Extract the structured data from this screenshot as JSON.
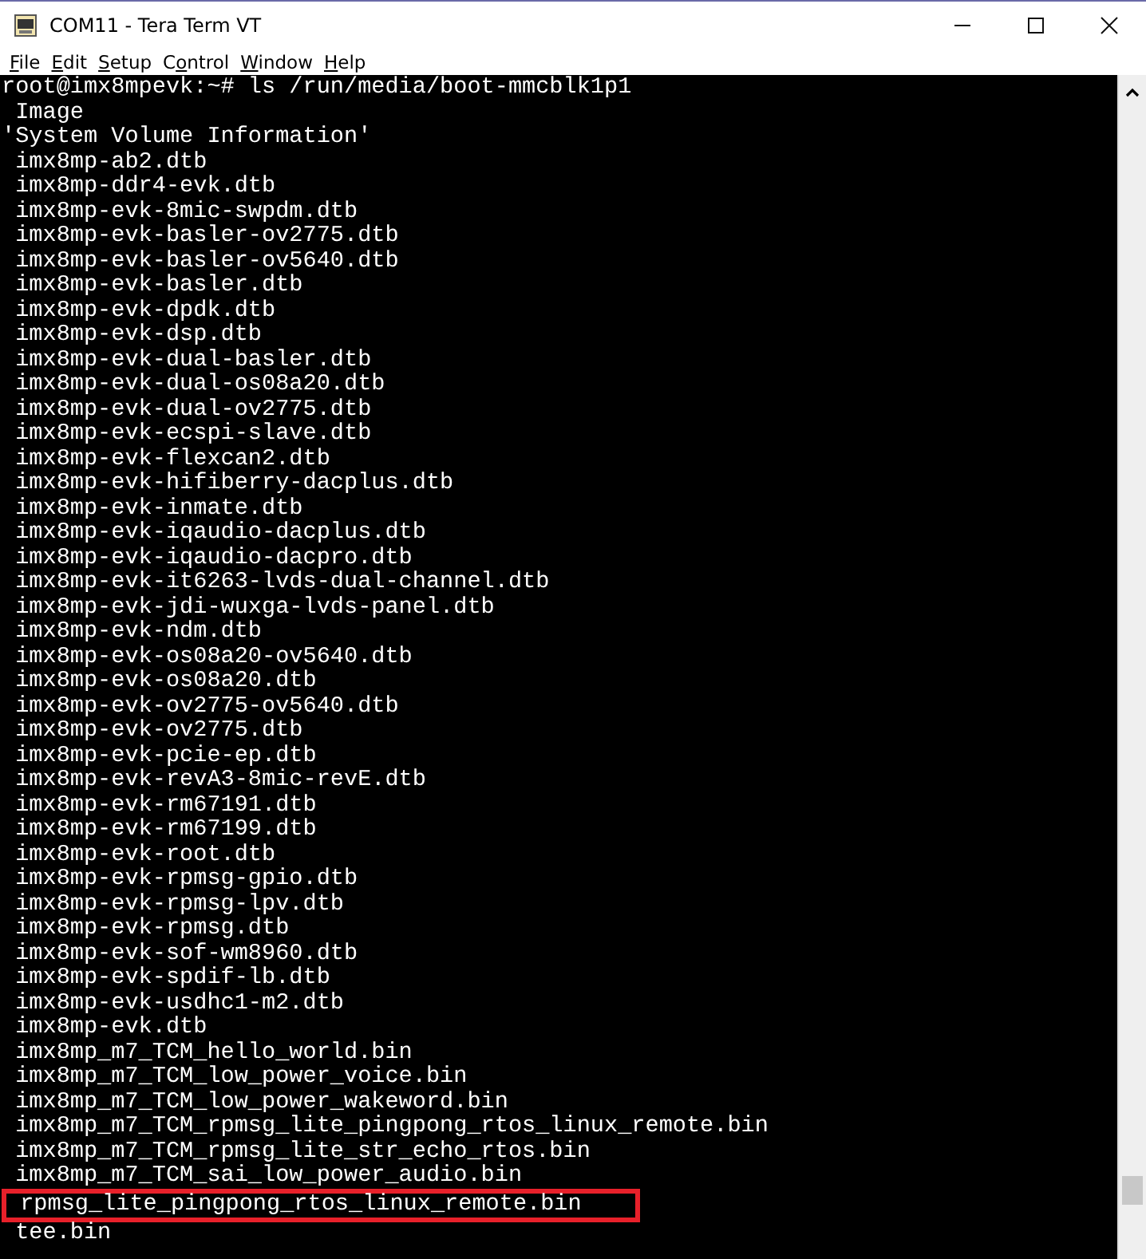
{
  "window": {
    "title": "COM11 - Tera Term VT"
  },
  "menu": [
    {
      "key": "F",
      "post": "ile"
    },
    {
      "key": "E",
      "post": "dit"
    },
    {
      "key": "S",
      "post": "etup"
    },
    {
      "pre": "C",
      "key": "o",
      "post": "ntrol"
    },
    {
      "key": "W",
      "post": "indow"
    },
    {
      "key": "H",
      "post": "elp"
    }
  ],
  "terminal": {
    "lines": [
      {
        "text": "root@imx8mpevk:~# ls /run/media/boot-mmcblk1p1",
        "highlighted": false
      },
      {
        "text": " Image",
        "highlighted": false
      },
      {
        "text": "'System Volume Information'",
        "highlighted": false
      },
      {
        "text": " imx8mp-ab2.dtb",
        "highlighted": false
      },
      {
        "text": " imx8mp-ddr4-evk.dtb",
        "highlighted": false
      },
      {
        "text": " imx8mp-evk-8mic-swpdm.dtb",
        "highlighted": false
      },
      {
        "text": " imx8mp-evk-basler-ov2775.dtb",
        "highlighted": false
      },
      {
        "text": " imx8mp-evk-basler-ov5640.dtb",
        "highlighted": false
      },
      {
        "text": " imx8mp-evk-basler.dtb",
        "highlighted": false
      },
      {
        "text": " imx8mp-evk-dpdk.dtb",
        "highlighted": false
      },
      {
        "text": " imx8mp-evk-dsp.dtb",
        "highlighted": false
      },
      {
        "text": " imx8mp-evk-dual-basler.dtb",
        "highlighted": false
      },
      {
        "text": " imx8mp-evk-dual-os08a20.dtb",
        "highlighted": false
      },
      {
        "text": " imx8mp-evk-dual-ov2775.dtb",
        "highlighted": false
      },
      {
        "text": " imx8mp-evk-ecspi-slave.dtb",
        "highlighted": false
      },
      {
        "text": " imx8mp-evk-flexcan2.dtb",
        "highlighted": false
      },
      {
        "text": " imx8mp-evk-hifiberry-dacplus.dtb",
        "highlighted": false
      },
      {
        "text": " imx8mp-evk-inmate.dtb",
        "highlighted": false
      },
      {
        "text": " imx8mp-evk-iqaudio-dacplus.dtb",
        "highlighted": false
      },
      {
        "text": " imx8mp-evk-iqaudio-dacpro.dtb",
        "highlighted": false
      },
      {
        "text": " imx8mp-evk-it6263-lvds-dual-channel.dtb",
        "highlighted": false
      },
      {
        "text": " imx8mp-evk-jdi-wuxga-lvds-panel.dtb",
        "highlighted": false
      },
      {
        "text": " imx8mp-evk-ndm.dtb",
        "highlighted": false
      },
      {
        "text": " imx8mp-evk-os08a20-ov5640.dtb",
        "highlighted": false
      },
      {
        "text": " imx8mp-evk-os08a20.dtb",
        "highlighted": false
      },
      {
        "text": " imx8mp-evk-ov2775-ov5640.dtb",
        "highlighted": false
      },
      {
        "text": " imx8mp-evk-ov2775.dtb",
        "highlighted": false
      },
      {
        "text": " imx8mp-evk-pcie-ep.dtb",
        "highlighted": false
      },
      {
        "text": " imx8mp-evk-revA3-8mic-revE.dtb",
        "highlighted": false
      },
      {
        "text": " imx8mp-evk-rm67191.dtb",
        "highlighted": false
      },
      {
        "text": " imx8mp-evk-rm67199.dtb",
        "highlighted": false
      },
      {
        "text": " imx8mp-evk-root.dtb",
        "highlighted": false
      },
      {
        "text": " imx8mp-evk-rpmsg-gpio.dtb",
        "highlighted": false
      },
      {
        "text": " imx8mp-evk-rpmsg-lpv.dtb",
        "highlighted": false
      },
      {
        "text": " imx8mp-evk-rpmsg.dtb",
        "highlighted": false
      },
      {
        "text": " imx8mp-evk-sof-wm8960.dtb",
        "highlighted": false
      },
      {
        "text": " imx8mp-evk-spdif-lb.dtb",
        "highlighted": false
      },
      {
        "text": " imx8mp-evk-usdhc1-m2.dtb",
        "highlighted": false
      },
      {
        "text": " imx8mp-evk.dtb",
        "highlighted": false
      },
      {
        "text": " imx8mp_m7_TCM_hello_world.bin",
        "highlighted": false
      },
      {
        "text": " imx8mp_m7_TCM_low_power_voice.bin",
        "highlighted": false
      },
      {
        "text": " imx8mp_m7_TCM_low_power_wakeword.bin",
        "highlighted": false
      },
      {
        "text": " imx8mp_m7_TCM_rpmsg_lite_pingpong_rtos_linux_remote.bin",
        "highlighted": false
      },
      {
        "text": " imx8mp_m7_TCM_rpmsg_lite_str_echo_rtos.bin",
        "highlighted": false
      },
      {
        "text": " imx8mp_m7_TCM_sai_low_power_audio.bin",
        "highlighted": false
      },
      {
        "text": " rpmsg_lite_pingpong_rtos_linux_remote.bin",
        "highlighted": true
      },
      {
        "text": " tee.bin",
        "highlighted": false
      }
    ]
  }
}
